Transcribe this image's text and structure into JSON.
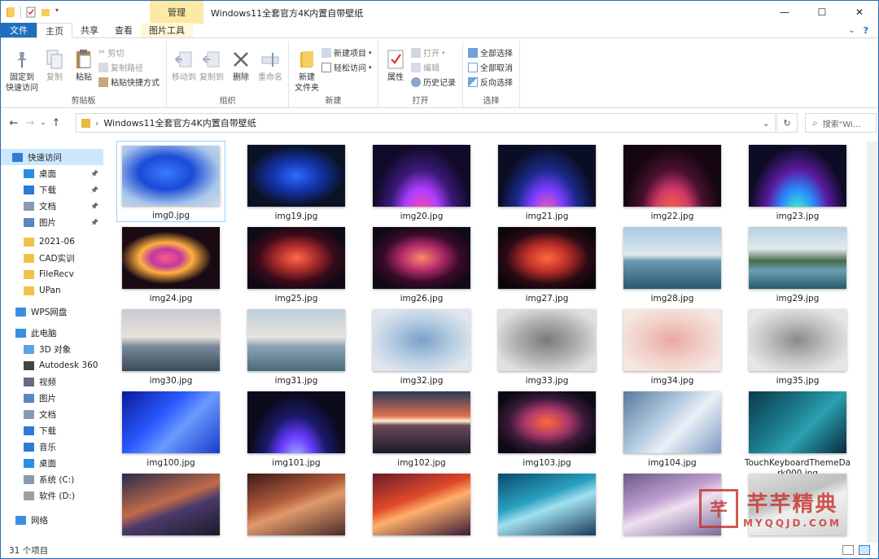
{
  "titlebar": {
    "manage_tab": "管理",
    "title": "Windows11全套官方4K内置自带壁纸",
    "min": "—",
    "max": "☐",
    "close": "✕"
  },
  "tabs": {
    "file": "文件",
    "home": "主页",
    "share": "共享",
    "view": "查看",
    "picture_tools": "图片工具",
    "help": "?"
  },
  "ribbon": {
    "clipboard": {
      "label": "剪贴板",
      "pin": "固定到\n快速访问",
      "copy": "复制",
      "paste": "粘贴",
      "cut": "剪切",
      "copy_path": "复制路径",
      "paste_shortcut": "粘贴快捷方式"
    },
    "organize": {
      "label": "组织",
      "move_to": "移动到",
      "copy_to": "复制到",
      "delete": "删除",
      "rename": "重命名"
    },
    "new": {
      "label": "新建",
      "new_folder": "新建\n文件夹",
      "new_item": "新建项目",
      "easy_access": "轻松访问"
    },
    "open": {
      "label": "打开",
      "properties": "属性",
      "open": "打开",
      "edit": "编辑",
      "history": "历史记录"
    },
    "select": {
      "label": "选择",
      "select_all": "全部选择",
      "select_none": "全部取消",
      "invert": "反向选择"
    }
  },
  "address": {
    "path": "Windows11全套官方4K内置自带壁纸",
    "search_placeholder": "搜索\"Wi..."
  },
  "sidebar": [
    {
      "label": "快速访问",
      "icon": "star-icon",
      "selected": true
    },
    {
      "label": "桌面",
      "icon": "desktop-icon",
      "pinned": true
    },
    {
      "label": "下载",
      "icon": "download-icon",
      "pinned": true
    },
    {
      "label": "文档",
      "icon": "document-icon",
      "pinned": true
    },
    {
      "label": "图片",
      "icon": "picture-icon",
      "pinned": true
    },
    {
      "label": "2021-06",
      "icon": "folder-icon"
    },
    {
      "label": "CAD实训",
      "icon": "folder-icon"
    },
    {
      "label": "FileRecv",
      "icon": "folder-icon"
    },
    {
      "label": "UPan",
      "icon": "folder-icon"
    },
    {
      "label": "WPS网盘",
      "icon": "cloud-icon"
    },
    {
      "label": "此电脑",
      "icon": "computer-icon"
    },
    {
      "label": "3D 对象",
      "icon": "3d-objects-icon"
    },
    {
      "label": "Autodesk 360",
      "icon": "autodesk-icon"
    },
    {
      "label": "视频",
      "icon": "video-icon"
    },
    {
      "label": "图片",
      "icon": "picture-icon"
    },
    {
      "label": "文档",
      "icon": "document-icon"
    },
    {
      "label": "下载",
      "icon": "download-icon"
    },
    {
      "label": "音乐",
      "icon": "music-icon"
    },
    {
      "label": "桌面",
      "icon": "desktop-icon"
    },
    {
      "label": "系统 (C:)",
      "icon": "drive-c-icon"
    },
    {
      "label": "软件 (D:)",
      "icon": "drive-d-icon"
    },
    {
      "label": "网络",
      "icon": "network-icon"
    }
  ],
  "files": [
    {
      "name": "img0.jpg",
      "selected": true
    },
    {
      "name": "img19.jpg"
    },
    {
      "name": "img20.jpg"
    },
    {
      "name": "img21.jpg"
    },
    {
      "name": "img22.jpg"
    },
    {
      "name": "img23.jpg"
    },
    {
      "name": "img24.jpg"
    },
    {
      "name": "img25.jpg"
    },
    {
      "name": "img26.jpg"
    },
    {
      "name": "img27.jpg"
    },
    {
      "name": "img28.jpg"
    },
    {
      "name": "img29.jpg"
    },
    {
      "name": "img30.jpg"
    },
    {
      "name": "img31.jpg"
    },
    {
      "name": "img32.jpg"
    },
    {
      "name": "img33.jpg"
    },
    {
      "name": "img34.jpg"
    },
    {
      "name": "img35.jpg"
    },
    {
      "name": "img100.jpg"
    },
    {
      "name": "img101.jpg"
    },
    {
      "name": "img102.jpg"
    },
    {
      "name": "img103.jpg"
    },
    {
      "name": "img104.jpg"
    },
    {
      "name": "TouchKeyboardThemeDark000.jpg"
    },
    {
      "name": ""
    },
    {
      "name": ""
    },
    {
      "name": ""
    },
    {
      "name": ""
    },
    {
      "name": ""
    },
    {
      "name": ""
    }
  ],
  "status": {
    "count": "31 个项目"
  },
  "watermark": {
    "cn": "芊芊精典",
    "en": "MYQQJD.COM"
  },
  "colors": {
    "accent": "#1e6fbf",
    "selection": "#cce8ff",
    "manage_tab": "#fce9a3"
  }
}
